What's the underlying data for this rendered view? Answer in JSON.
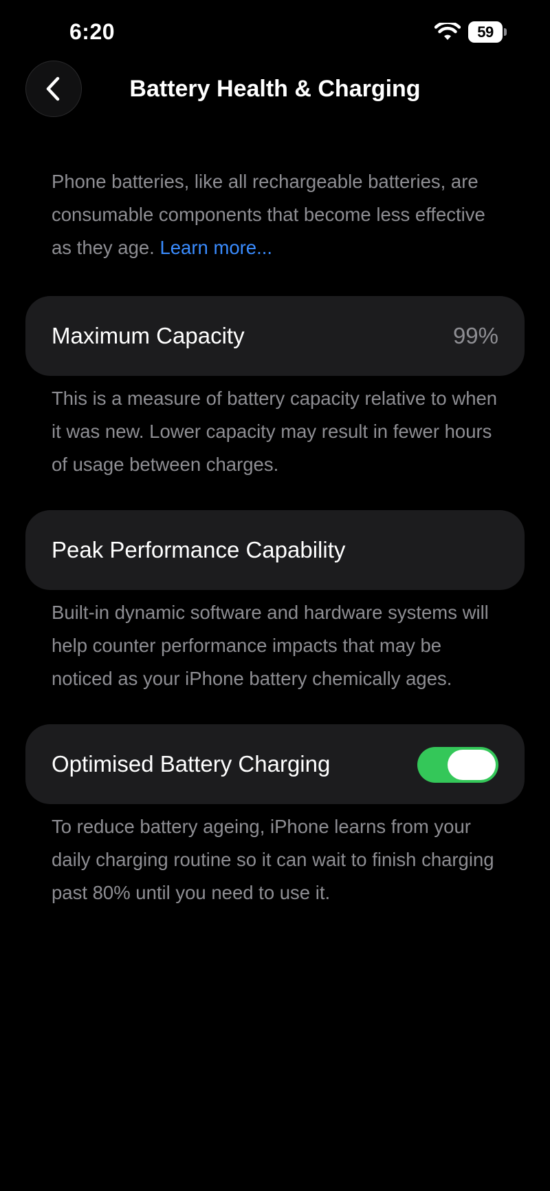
{
  "status_bar": {
    "time": "6:20",
    "battery_level": "59",
    "wifi_icon": "wifi-icon",
    "battery_icon": "battery-icon"
  },
  "nav": {
    "back_icon": "chevron-left-icon",
    "title": "Battery Health & Charging"
  },
  "intro": {
    "text": "Phone batteries, like all rechargeable batteries, are consumable components that become less effective as they age.",
    "link": "Learn more..."
  },
  "maximum_capacity": {
    "label": "Maximum Capacity",
    "value": "99%",
    "footer": "This is a measure of battery capacity relative to when it was new. Lower capacity may result in fewer hours of usage between charges."
  },
  "peak_performance": {
    "label": "Peak Performance Capability",
    "footer": "Built-in dynamic software and hardware systems will help counter performance impacts that may be noticed as your iPhone battery chemically ages."
  },
  "optimised_charging": {
    "label": "Optimised Battery Charging",
    "enabled": true,
    "footer": "To reduce battery ageing, iPhone learns from your daily charging routine so it can wait to finish charging past 80% until you need to use it."
  },
  "colors": {
    "background": "#000000",
    "card": "#1c1c1e",
    "secondary_text": "#8e8e93",
    "link": "#3a8cff",
    "toggle_on": "#34c759"
  }
}
